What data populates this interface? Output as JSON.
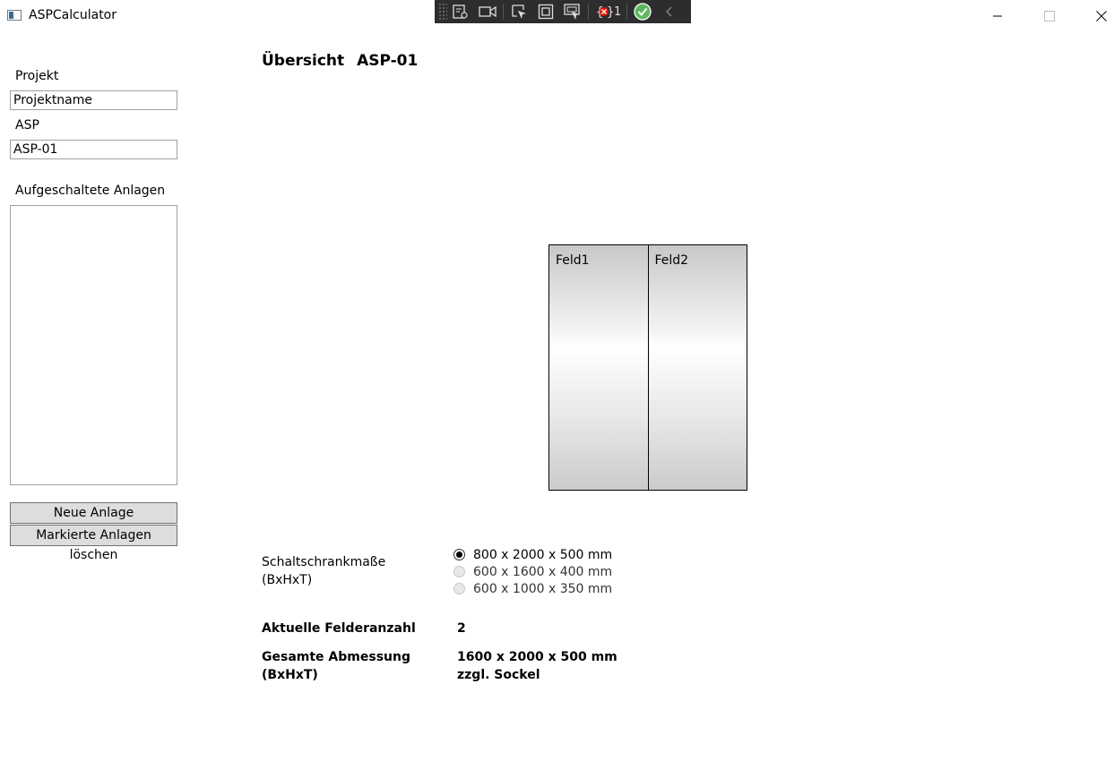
{
  "window": {
    "title": "ASPCalculator"
  },
  "debug_toolbar": {
    "binding_errors_count": "1"
  },
  "sidebar": {
    "project_label": "Projekt",
    "project_value": "Projektname",
    "asp_label": "ASP",
    "asp_value": "ASP-01",
    "plants_label": "Aufgeschaltete Anlagen",
    "plants_items": [],
    "new_plant_button": "Neue Anlage",
    "delete_plants_button": "Markierte Anlagen löschen"
  },
  "main": {
    "heading_prefix": "Übersicht",
    "heading_asp": "ASP-01",
    "fields": [
      {
        "label": "Feld1"
      },
      {
        "label": "Feld2"
      }
    ],
    "dimensions": {
      "label_line1": "Schaltschrankmaße",
      "label_line2": "(BxHxT)",
      "options": [
        {
          "label": "800 x 2000 x 500 mm",
          "selected": true
        },
        {
          "label": "600 x 1600 x 400 mm",
          "selected": false
        },
        {
          "label": "600 x 1000 x 350 mm",
          "selected": false
        }
      ]
    },
    "field_count_label": "Aktuelle Felderanzahl",
    "field_count_value": "2",
    "total_dim_label_line1": "Gesamte Abmessung",
    "total_dim_label_line2": "(BxHxT)",
    "total_dim_value_line1": "1600 x 2000 x 500 mm",
    "total_dim_value_line2": "zzgl. Sockel"
  }
}
